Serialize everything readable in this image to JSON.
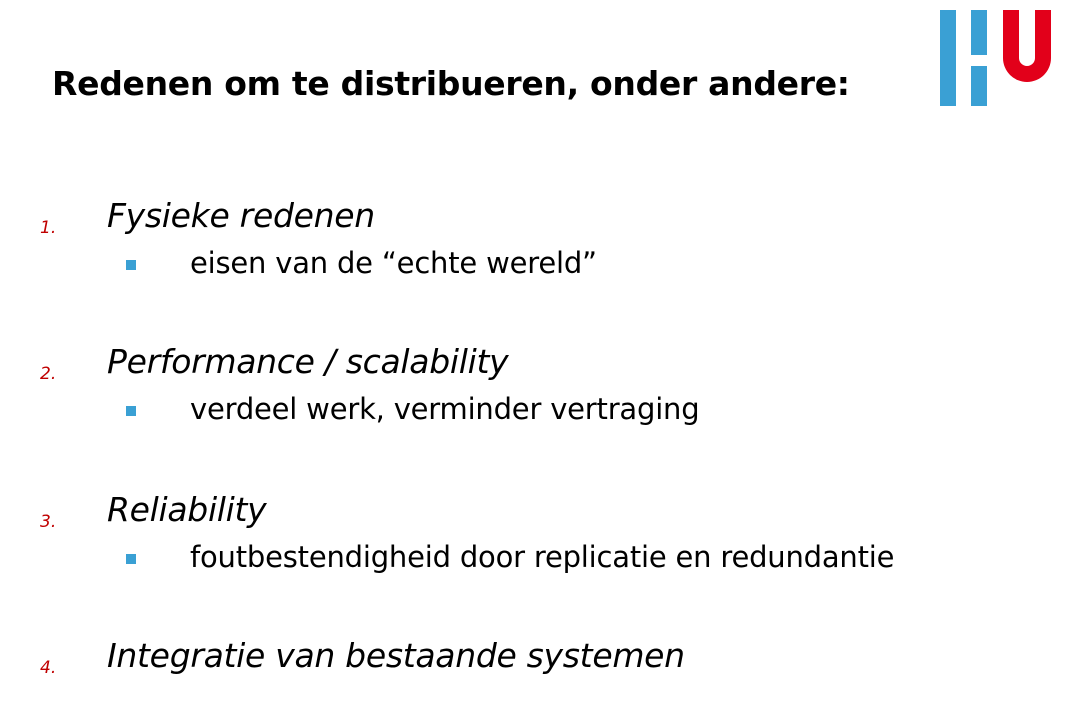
{
  "title": "Redenen om te distribueren, onder andere:",
  "colors": {
    "logo_blue": "#3aa0d4",
    "logo_red": "#e2001a",
    "number_red": "#c00000"
  },
  "items": [
    {
      "number": "1.",
      "label": "Fysieke redenen",
      "sub": "eisen van de “echte wereld”"
    },
    {
      "number": "2.",
      "label": "Performance / scalability",
      "sub": "verdeel werk, verminder vertraging"
    },
    {
      "number": "3.",
      "label": "Reliability",
      "sub": "foutbestendigheid door replicatie en redundantie"
    },
    {
      "number": "4.",
      "label": "Integratie van bestaande systemen"
    }
  ]
}
